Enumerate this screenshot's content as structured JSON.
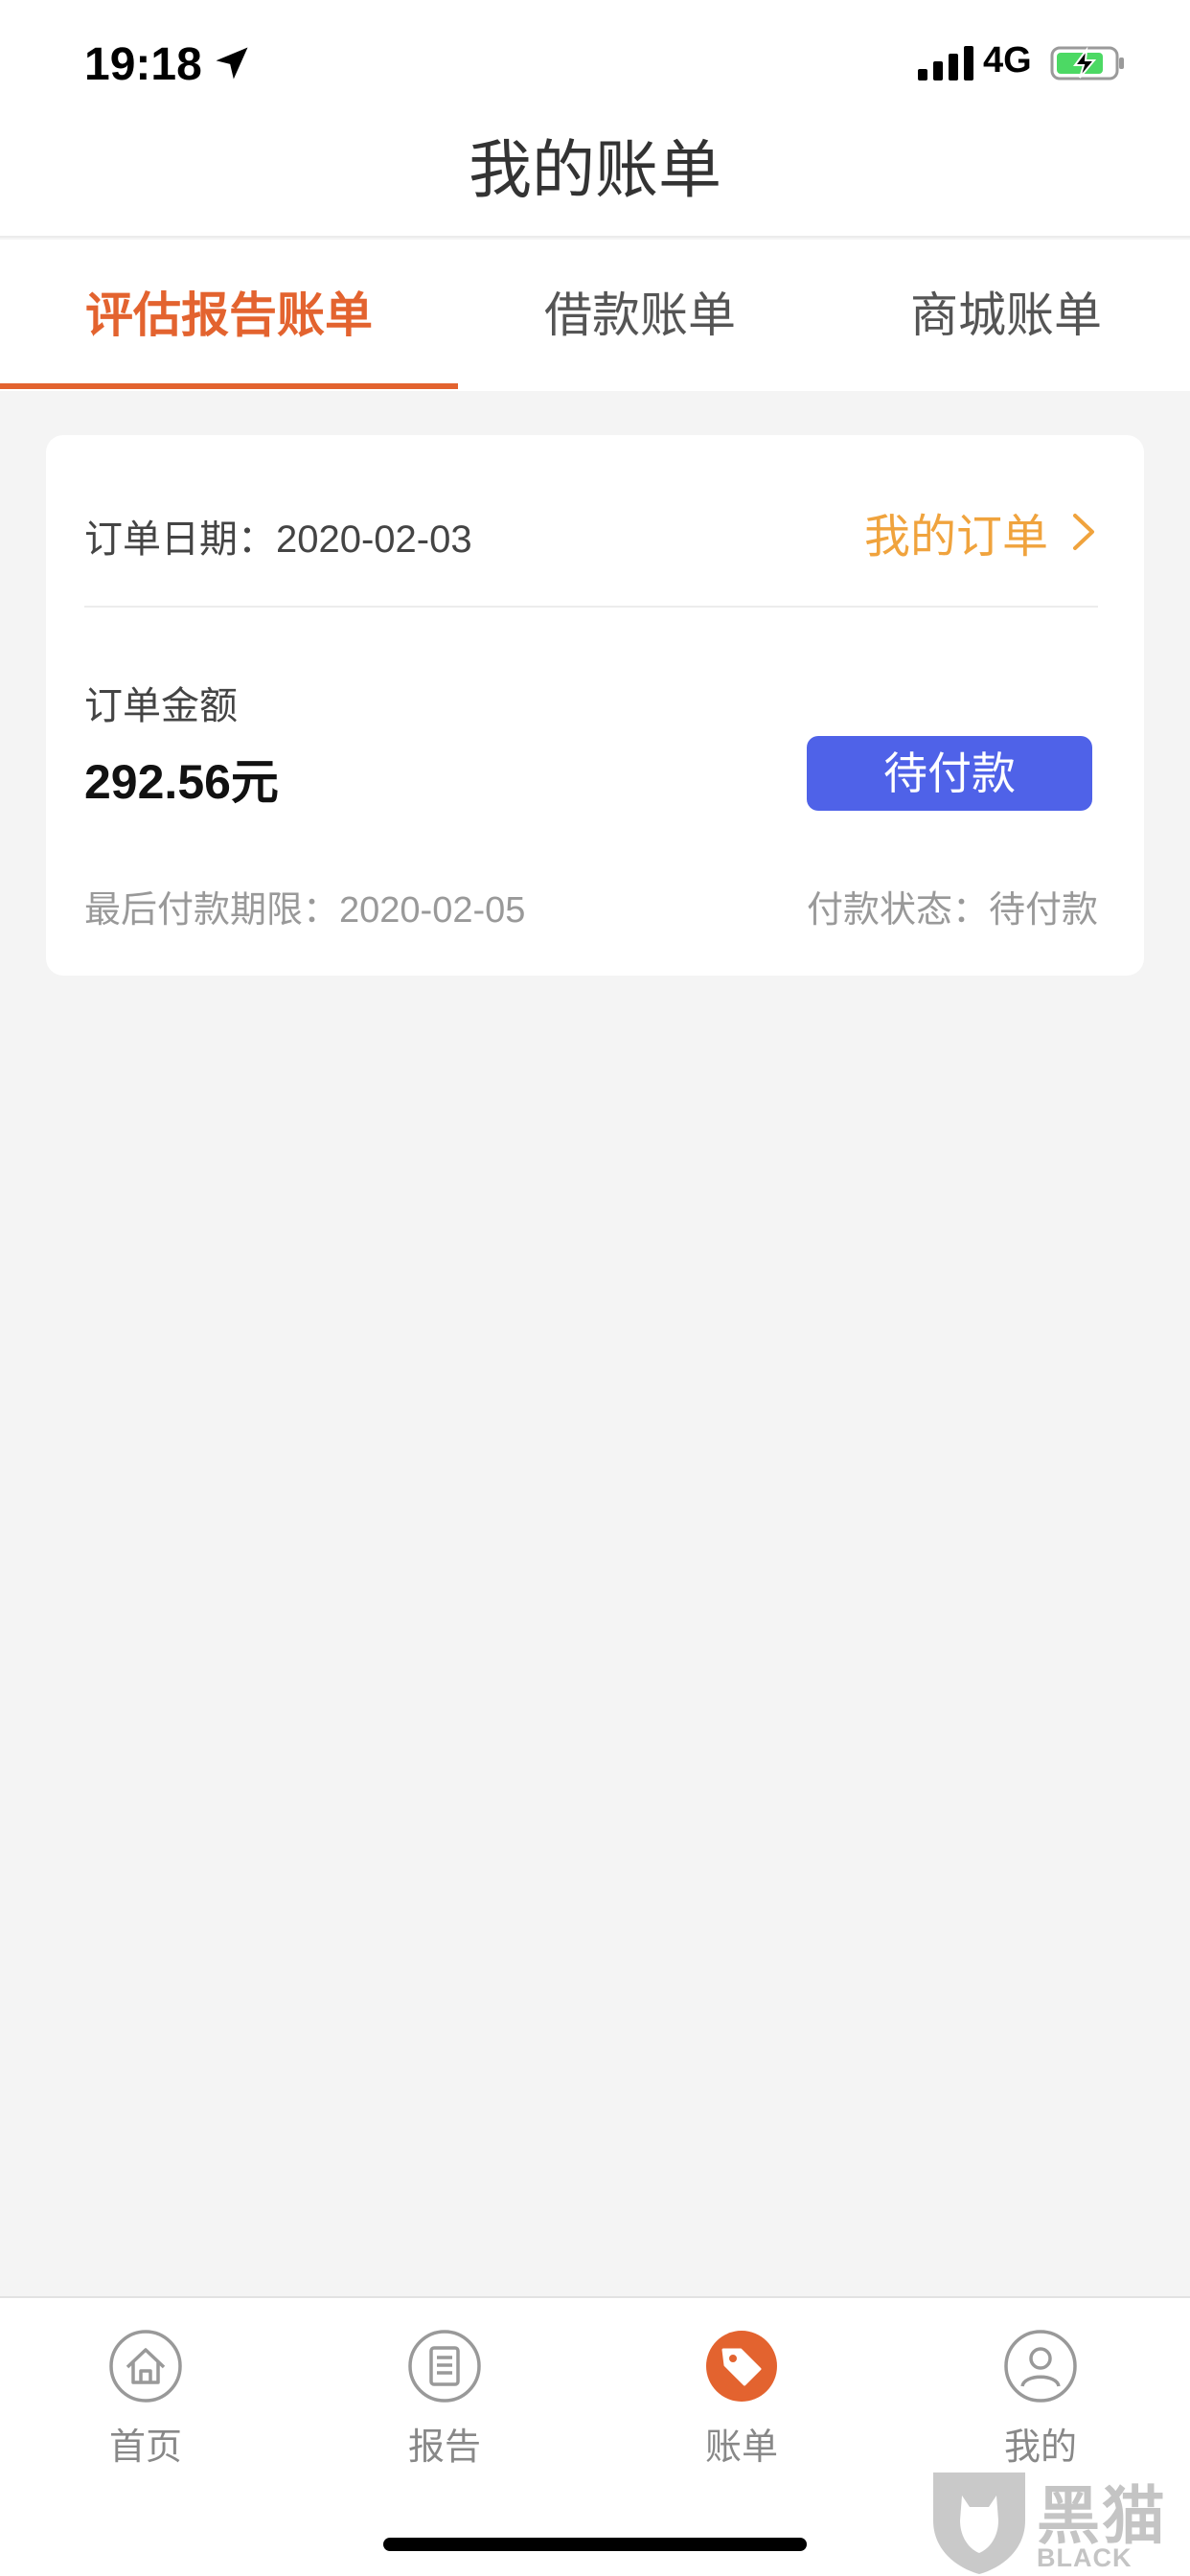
{
  "status_bar": {
    "time": "19:18",
    "network": "4G",
    "icons": [
      "location-arrow-icon",
      "signal-bars-icon",
      "battery-charging-icon"
    ]
  },
  "header": {
    "title": "我的账单"
  },
  "tabs": [
    {
      "label": "评估报告账单",
      "active": true
    },
    {
      "label": "借款账单",
      "active": false
    },
    {
      "label": "商城账单",
      "active": false
    }
  ],
  "bill_card": {
    "order_date_label": "订单日期：",
    "order_date": "2020-02-03",
    "my_orders_label": "我的订单",
    "amount_label": "订单金额",
    "amount_value": "292.56元",
    "pay_button_label": "待付款",
    "deadline_label": "最后付款期限：",
    "deadline": "2020-02-05",
    "status_label": "付款状态：",
    "status": "待付款"
  },
  "bottom_nav": {
    "items": [
      {
        "label": "首页",
        "icon": "home-icon",
        "active": false
      },
      {
        "label": "报告",
        "icon": "report-icon",
        "active": false
      },
      {
        "label": "账单",
        "icon": "bill-tag-icon",
        "active": true
      },
      {
        "label": "我的",
        "icon": "profile-icon",
        "active": false
      }
    ]
  },
  "watermark": {
    "text_cn": "黑猫",
    "text_en": "BLACK CAT"
  },
  "colors": {
    "accent_orange": "#e3632f",
    "link_orange": "#f0a33d",
    "button_blue": "#4f62e8",
    "background": "#f4f4f4",
    "battery_green": "#4cd964"
  }
}
